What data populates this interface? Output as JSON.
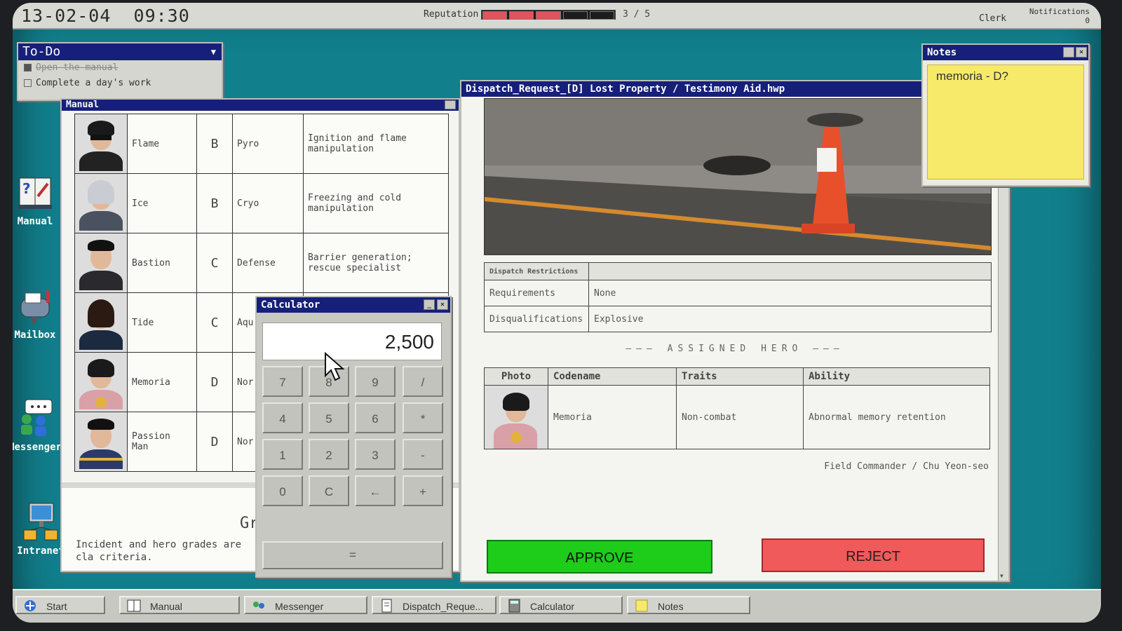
{
  "topbar": {
    "date": "13-02-04",
    "time": "09:30",
    "reputation_label": "Reputation",
    "reputation_value": "3 / 5",
    "reputation_filled": 3,
    "reputation_total": 5,
    "role": "Clerk",
    "notifications_label": "Notifications",
    "notifications_count": "0"
  },
  "todo": {
    "title": "To-Do",
    "items": [
      {
        "label": "Open the manual",
        "done": true
      },
      {
        "label": "Complete a day's work",
        "done": false
      }
    ]
  },
  "desktop": {
    "icons": [
      "Manual",
      "Mailbox",
      "Messenger",
      "Intranet"
    ]
  },
  "manual": {
    "title": "Manual",
    "heroes": [
      {
        "name": "Flame",
        "grade": "B",
        "trait": "Pyro",
        "ability": "Ignition and flame manipulation"
      },
      {
        "name": "Ice",
        "grade": "B",
        "trait": "Cryo",
        "ability": "Freezing and cold manipulation"
      },
      {
        "name": "Bastion",
        "grade": "C",
        "trait": "Defense",
        "ability": "Barrier generation; rescue specialist"
      },
      {
        "name": "Tide",
        "grade": "C",
        "trait": "Aqu",
        "ability": ""
      },
      {
        "name": "Memoria",
        "grade": "D",
        "trait": "Nor",
        "ability": ""
      },
      {
        "name": "Passion Man",
        "grade": "D",
        "trait": "Nor",
        "ability": ""
      }
    ],
    "grades_title": "Gr",
    "grades_text": "Incident and hero grades are cla criteria."
  },
  "calculator": {
    "title": "Calculator",
    "display": "2,500",
    "keys": [
      "7",
      "8",
      "9",
      "/",
      "4",
      "5",
      "6",
      "*",
      "1",
      "2",
      "3",
      "-",
      "0",
      "C",
      "←",
      "+"
    ],
    "equals": "="
  },
  "dispatch": {
    "title": "Dispatch_Request_[D] Lost Property / Testimony Aid.hwp",
    "restrictions_header": "Dispatch Restrictions",
    "requirements_label": "Requirements",
    "requirements_value": "None",
    "disqualifications_label": "Disqualifications",
    "disqualifications_value": "Explosive",
    "assigned_label": "ASSIGNED HERO",
    "columns": [
      "Photo",
      "Codename",
      "Traits",
      "Ability"
    ],
    "hero": {
      "codename": "Memoria",
      "traits": "Non-combat",
      "ability": "Abnormal memory retention"
    },
    "commander": "Field Commander / Chu Yeon-seo",
    "approve": "APPROVE",
    "reject": "REJECT"
  },
  "notes": {
    "title": "Notes",
    "text": "memoria - D?"
  },
  "taskbar": {
    "start": "Start",
    "tasks": [
      "Manual",
      "Messenger",
      "Dispatch_Reque...",
      "Calculator",
      "Notes"
    ]
  },
  "colors": {
    "desktop": "#117f8c",
    "titlebar": "#16207a",
    "approve": "#1ecc1a",
    "reject": "#f05a5a",
    "sticky": "#f7e96a",
    "reputation_filled": "#e0545a"
  }
}
